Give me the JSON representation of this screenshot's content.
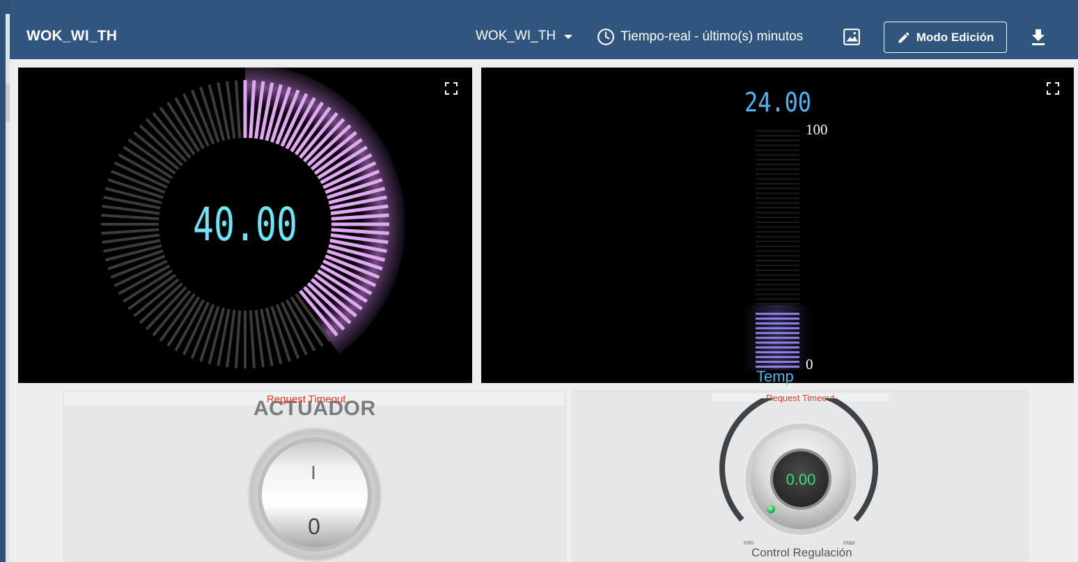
{
  "header": {
    "title": "WOK_WI_TH",
    "state_label": "WOK_WI_TH",
    "timewindow_label": "Tiempo-real - último(s) minutos",
    "edit_label": "Modo Edición"
  },
  "widgets": {
    "radial_gauge": {
      "value_text": "40.00",
      "value": 40,
      "min": 0,
      "max": 100,
      "bar_color": "#e3a6f5",
      "track_color": "#3c3c3c"
    },
    "linear_gauge": {
      "value_text": "24.00",
      "value": 24,
      "min": 0,
      "max": 100,
      "max_label": "100",
      "min_label": "0",
      "label": "Temp",
      "bar_color": "#8f84e6"
    },
    "actuator": {
      "title": "ACTUADOR",
      "error": "Request Timeout.",
      "on_label": "I",
      "off_label": "0"
    },
    "control": {
      "title": "Control Regulación",
      "error": "Request Timeout.",
      "value_text": "0.00",
      "min_label": "min",
      "max_label": "max",
      "value_color": "#35e07a"
    }
  },
  "icons": {
    "clock": "clock-icon",
    "image": "image-icon",
    "edit": "pencil-icon",
    "download": "download-icon",
    "fullscreen": "fullscreen-icon"
  }
}
